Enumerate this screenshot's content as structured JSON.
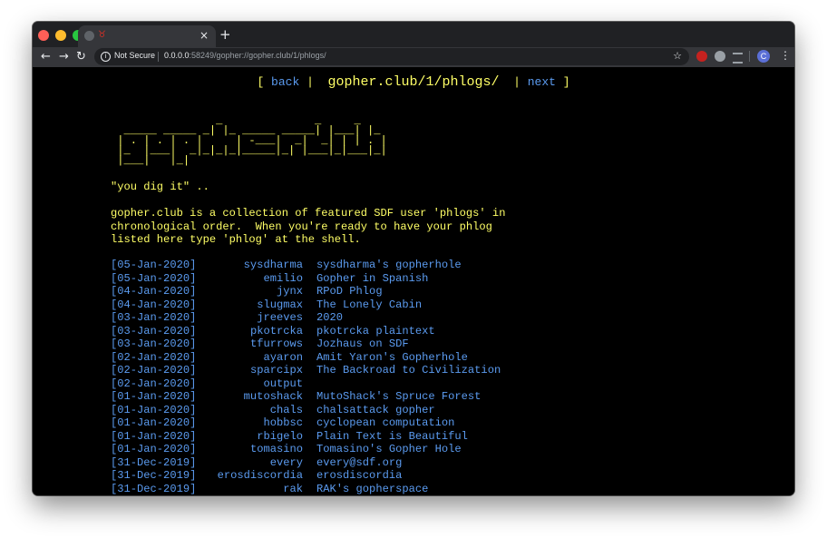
{
  "browser": {
    "tab_favicon_glyph": "♉",
    "tab_close": "×",
    "new_tab": "+",
    "back": "←",
    "forward": "→",
    "reload": "↻",
    "info_glyph": "i",
    "security": "Not Secure",
    "url_host": "0.0.0.0",
    "url_rest": ":58249/gopher://gopher.club/1/phlogs/",
    "star": "☆",
    "profile_initial": "C",
    "menu": "⋮"
  },
  "nav": {
    "open": "[ ",
    "back": "back",
    "sep1": " |  ",
    "path": "gopher.club/1/phlogs/",
    "sep2": "  | ",
    "next": "next",
    "close": " ]"
  },
  "ascii_logo": "                _              _     _\n  _____ _____ _| |_ _____ _____| |___| |_\n | . | . | . |     | -___|  _|  _| | | . |\n |_  |___|  _|_|_|_|_____|_| |___|_|___|_|\n |___|   |_|",
  "tagline": "\"you dig it\" ..",
  "intro": "gopher.club is a collection of featured SDF user 'phlogs' in\nchronological order.  When you're ready to have your phlog\nlisted here type 'phlog' at the shell.",
  "phlogs": [
    {
      "date": "[05-Jan-2020]",
      "user": "sysdharma",
      "title": "sysdharma's gopherhole"
    },
    {
      "date": "[05-Jan-2020]",
      "user": "emilio",
      "title": "Gopher in Spanish"
    },
    {
      "date": "[04-Jan-2020]",
      "user": "jynx",
      "title": "RPoD Phlog"
    },
    {
      "date": "[04-Jan-2020]",
      "user": "slugmax",
      "title": "The Lonely Cabin"
    },
    {
      "date": "[03-Jan-2020]",
      "user": "jreeves",
      "title": "2020"
    },
    {
      "date": "[03-Jan-2020]",
      "user": "pkotrcka",
      "title": "pkotrcka plaintext"
    },
    {
      "date": "[03-Jan-2020]",
      "user": "tfurrows",
      "title": "Jozhaus on SDF"
    },
    {
      "date": "[02-Jan-2020]",
      "user": "ayaron",
      "title": "Amit Yaron's Gopherhole"
    },
    {
      "date": "[02-Jan-2020]",
      "user": "sparcipx",
      "title": "The Backroad to Civilization"
    },
    {
      "date": "[02-Jan-2020]",
      "user": "output",
      "title": ""
    },
    {
      "date": "[01-Jan-2020]",
      "user": "mutoshack",
      "title": "MutoShack's Spruce Forest"
    },
    {
      "date": "[01-Jan-2020]",
      "user": "chals",
      "title": "chalsattack gopher"
    },
    {
      "date": "[01-Jan-2020]",
      "user": "hobbsc",
      "title": "cyclopean computation"
    },
    {
      "date": "[01-Jan-2020]",
      "user": "rbigelo",
      "title": "Plain Text is Beautiful"
    },
    {
      "date": "[01-Jan-2020]",
      "user": "tomasino",
      "title": "Tomasino's Gopher Hole"
    },
    {
      "date": "[31-Dec-2019]",
      "user": "every",
      "title": "every@sdf.org"
    },
    {
      "date": "[31-Dec-2019]",
      "user": "erosdiscordia",
      "title": "erosdiscordia"
    },
    {
      "date": "[31-Dec-2019]",
      "user": "rak",
      "title": "RAK's gopherspace"
    }
  ],
  "colors": {
    "text_yellow": "#ffff66",
    "link_blue": "#5b9bf0",
    "background": "#000000"
  }
}
